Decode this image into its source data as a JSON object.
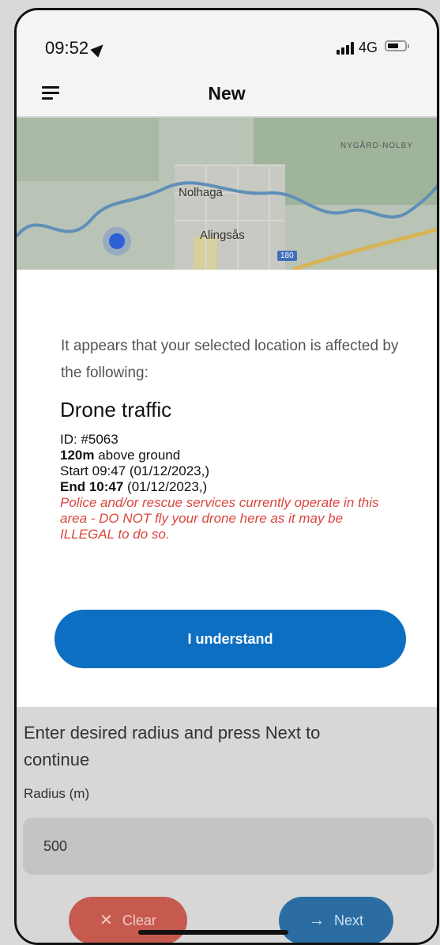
{
  "status_bar": {
    "time": "09:52",
    "network": "4G",
    "location_icon": "location-arrow-icon",
    "signal_icon": "signal-bars-icon",
    "battery_icon": "battery-icon"
  },
  "nav": {
    "title": "New",
    "menu_icon": "hamburger-menu-icon"
  },
  "map": {
    "labels": {
      "area": "NYGÅRD-NOLBY",
      "place1": "Nolhaga",
      "place2": "Alingsås",
      "road": "180"
    },
    "pin_icon": "location-pin-icon"
  },
  "modal": {
    "intro": "It appears that your selected location is affected by the following:",
    "title": "Drone traffic",
    "id_line": "ID: #5063",
    "altitude_value": "120m",
    "altitude_suffix": "above ground",
    "start_line": "Start 09:47 (01/12/2023,)",
    "end_label": "End 10:47",
    "end_date": "(01/12/2023,)",
    "warning": "Police and/or rescue services currently operate in this area - DO NOT fly your drone here as it may be ILLEGAL to do so.",
    "button_label": "I understand"
  },
  "form": {
    "instruction": "Enter desired radius and press Next to continue",
    "radius_label": "Radius (m)",
    "radius_value": "500",
    "clear_label": "Clear",
    "clear_icon": "close-icon",
    "next_label": "Next",
    "next_icon": "arrow-right-icon"
  },
  "colors": {
    "primary": "#0c6fc1",
    "danger_text": "#d9463d",
    "clear_bg": "#c75a4f",
    "next_bg": "#2b6da3"
  }
}
